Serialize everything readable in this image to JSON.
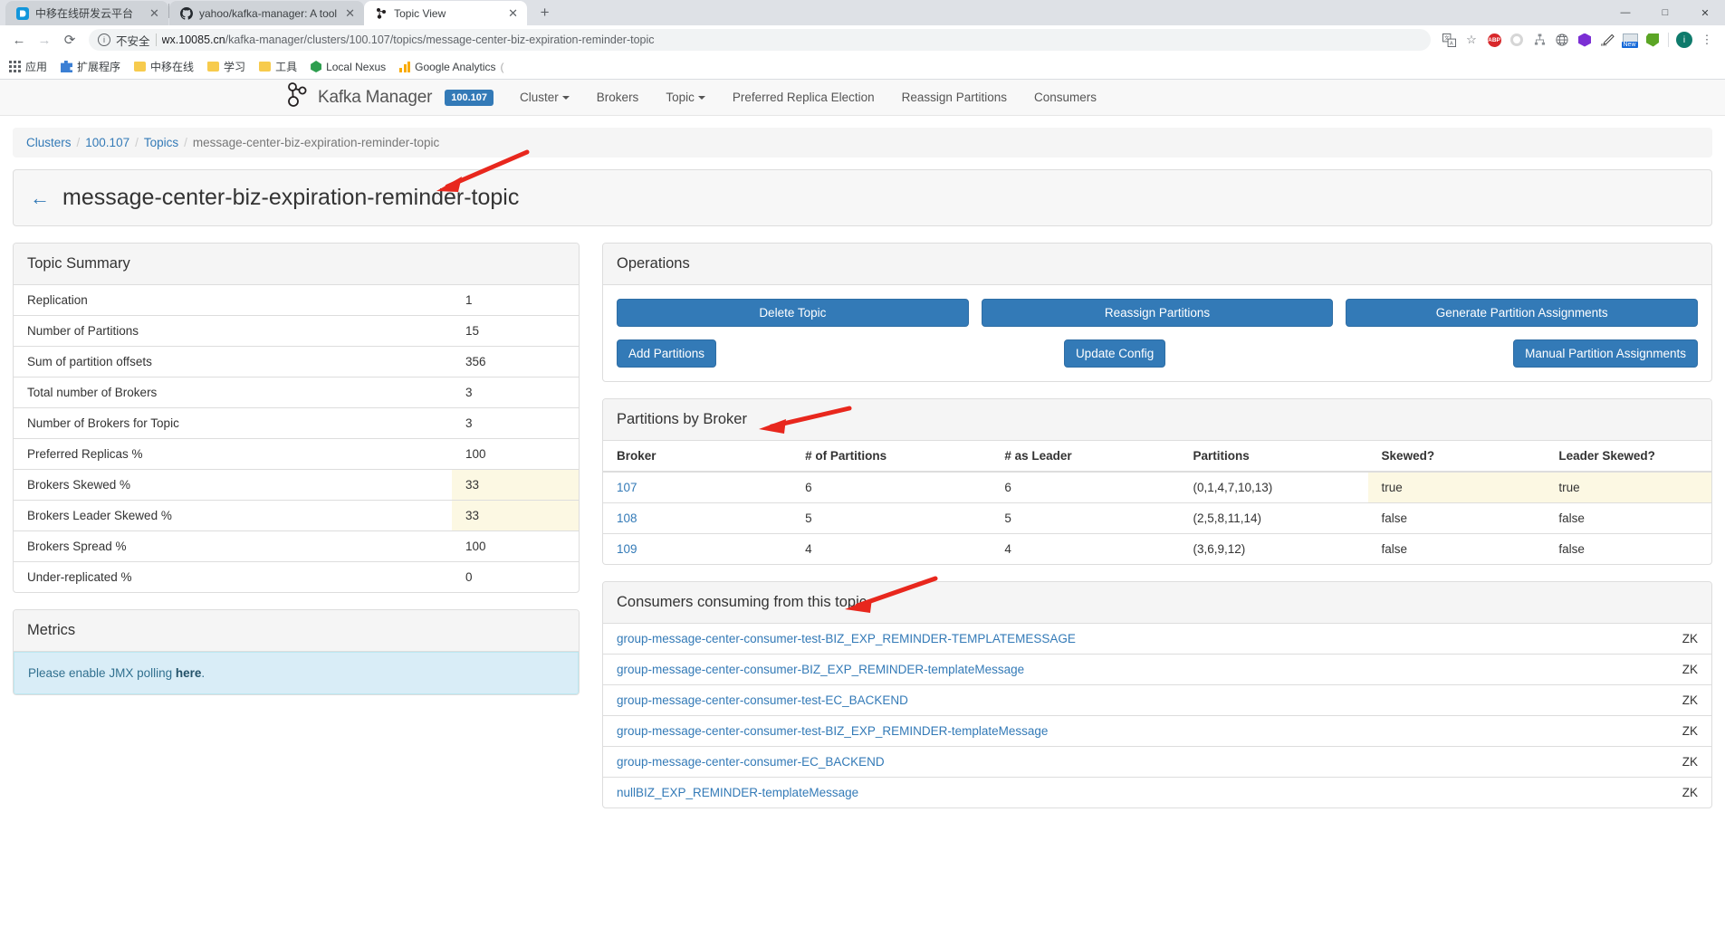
{
  "browser": {
    "tabs": [
      {
        "title": "中移在线研发云平台",
        "favicon": "dingtalk-icon",
        "active": false
      },
      {
        "title": "yahoo/kafka-manager: A tool",
        "favicon": "github-icon",
        "active": false
      },
      {
        "title": "Topic View",
        "favicon": "kafka-icon",
        "active": true
      }
    ],
    "new_tab_label": "+",
    "window_controls": {
      "minimize": "—",
      "maximize": "□",
      "close": "✕"
    },
    "nav": {
      "back": "←",
      "forward": "→",
      "reload": "⟳"
    },
    "omnibox": {
      "info_icon": "i",
      "security_label": "不安全",
      "url_host": "wx.10085.cn",
      "url_path": "/kafka-manager/clusters/100.107/topics/message-center-biz-expiration-reminder-topic"
    },
    "toolbar_icons": [
      "translate-icon",
      "bookmark-star-icon",
      "adblock-plus-icon",
      "opera-ring-icon",
      "tree-icon",
      "globe-wireframe-icon",
      "purple-hexagon-icon",
      "en-pen-icon",
      "screenshot-new-icon",
      "evernote-icon"
    ],
    "profile_initial": "i",
    "menu_icon": "kebab-menu-icon",
    "bookmarks": [
      {
        "label": "应用",
        "icon": "apps-grid-icon"
      },
      {
        "label": "扩展程序",
        "icon": "puzzle-icon"
      },
      {
        "label": "中移在线",
        "icon": "folder-icon"
      },
      {
        "label": "学习",
        "icon": "folder-icon"
      },
      {
        "label": "工具",
        "icon": "folder-icon"
      },
      {
        "label": "Local Nexus",
        "icon": "nexus-icon"
      },
      {
        "label": "Google Analytics",
        "icon": "analytics-icon"
      }
    ]
  },
  "navbar": {
    "brand": "Kafka Manager",
    "cluster_badge": "100.107",
    "links": [
      {
        "label": "Cluster",
        "dropdown": true
      },
      {
        "label": "Brokers",
        "dropdown": false
      },
      {
        "label": "Topic",
        "dropdown": true
      },
      {
        "label": "Preferred Replica Election",
        "dropdown": false
      },
      {
        "label": "Reassign Partitions",
        "dropdown": false
      },
      {
        "label": "Consumers",
        "dropdown": false
      }
    ]
  },
  "breadcrumb": {
    "items": [
      "Clusters",
      "100.107",
      "Topics",
      "message-center-biz-expiration-reminder-topic"
    ],
    "separator": "/"
  },
  "page_title": {
    "back_arrow": "←",
    "text": "message-center-biz-expiration-reminder-topic"
  },
  "topic_summary": {
    "heading": "Topic Summary",
    "rows": [
      {
        "label": "Replication",
        "value": "1",
        "warn": false
      },
      {
        "label": "Number of Partitions",
        "value": "15",
        "warn": false
      },
      {
        "label": "Sum of partition offsets",
        "value": "356",
        "warn": false
      },
      {
        "label": "Total number of Brokers",
        "value": "3",
        "warn": false
      },
      {
        "label": "Number of Brokers for Topic",
        "value": "3",
        "warn": false
      },
      {
        "label": "Preferred Replicas %",
        "value": "100",
        "warn": false
      },
      {
        "label": "Brokers Skewed %",
        "value": "33",
        "warn": true
      },
      {
        "label": "Brokers Leader Skewed %",
        "value": "33",
        "warn": true
      },
      {
        "label": "Brokers Spread %",
        "value": "100",
        "warn": false
      },
      {
        "label": "Under-replicated %",
        "value": "0",
        "warn": false
      }
    ]
  },
  "metrics": {
    "heading": "Metrics",
    "notice_prefix": "Please enable JMX polling ",
    "notice_link": "here",
    "notice_suffix": "."
  },
  "operations": {
    "heading": "Operations",
    "row1": [
      {
        "label": "Delete Topic"
      },
      {
        "label": "Reassign Partitions"
      },
      {
        "label": "Generate Partition Assignments"
      }
    ],
    "row2": [
      {
        "label": "Add Partitions"
      },
      {
        "label": "Update Config"
      },
      {
        "label": "Manual Partition Assignments"
      }
    ]
  },
  "partitions_by_broker": {
    "heading": "Partitions by Broker",
    "columns": [
      "Broker",
      "# of Partitions",
      "# as Leader",
      "Partitions",
      "Skewed?",
      "Leader Skewed?"
    ],
    "rows": [
      {
        "broker": "107",
        "num_partitions": "6",
        "as_leader": "6",
        "partitions": "(0,1,4,7,10,13)",
        "skewed": "true",
        "leader_skewed": "true",
        "skewed_warn": true,
        "leader_warn": true
      },
      {
        "broker": "108",
        "num_partitions": "5",
        "as_leader": "5",
        "partitions": "(2,5,8,11,14)",
        "skewed": "false",
        "leader_skewed": "false",
        "skewed_warn": false,
        "leader_warn": false
      },
      {
        "broker": "109",
        "num_partitions": "4",
        "as_leader": "4",
        "partitions": "(3,6,9,12)",
        "skewed": "false",
        "leader_skewed": "false",
        "skewed_warn": false,
        "leader_warn": false
      }
    ]
  },
  "consumers": {
    "heading": "Consumers consuming from this topic",
    "rows": [
      {
        "name": "group-message-center-consumer-test-BIZ_EXP_REMINDER-TEMPLATEMESSAGE",
        "type": "ZK"
      },
      {
        "name": "group-message-center-consumer-BIZ_EXP_REMINDER-templateMessage",
        "type": "ZK"
      },
      {
        "name": "group-message-center-consumer-test-EC_BACKEND",
        "type": "ZK"
      },
      {
        "name": "group-message-center-consumer-test-BIZ_EXP_REMINDER-templateMessage",
        "type": "ZK"
      },
      {
        "name": "group-message-center-consumer-EC_BACKEND",
        "type": "ZK"
      },
      {
        "name": "nullBIZ_EXP_REMINDER-templateMessage",
        "type": "ZK"
      }
    ]
  },
  "annotations": {
    "accent_color": "#e8271d",
    "arrows": [
      "title-arrow",
      "partitions-by-broker-arrow",
      "consumers-arrow"
    ]
  }
}
